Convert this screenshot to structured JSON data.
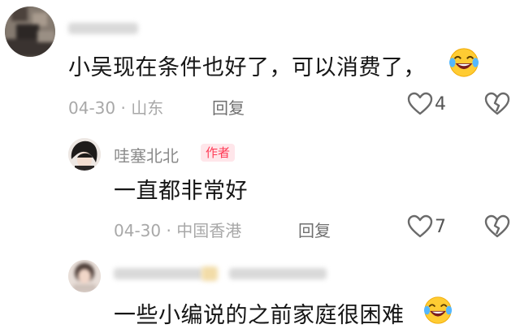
{
  "comments": [
    {
      "username": "█████",
      "text": "小吴现在条件也好了，可以消费了，",
      "date": "04-30",
      "location": "山东",
      "reply_label": "回复",
      "like_count": "4",
      "avatar_icon": "blurred-user-avatar",
      "emoji_icon": "laughing-crying-emoji"
    },
    {
      "username": "哇塞北北",
      "badge": "作者",
      "text": "一直都非常好",
      "date": "04-30",
      "location": "中国香港",
      "reply_label": "回复",
      "like_count": "7",
      "avatar_icon": "dark-hair-avatar"
    },
    {
      "username": "████ █████",
      "text": "一些小编说的之前家庭很困难",
      "avatar_icon": "blurred-user-avatar",
      "emoji_icon": "laughing-crying-emoji"
    }
  ],
  "separator": " · ",
  "colors": {
    "badge_text": "#ff3a55",
    "badge_bg": "#ffe6ea",
    "meta": "#a8a8a8"
  }
}
